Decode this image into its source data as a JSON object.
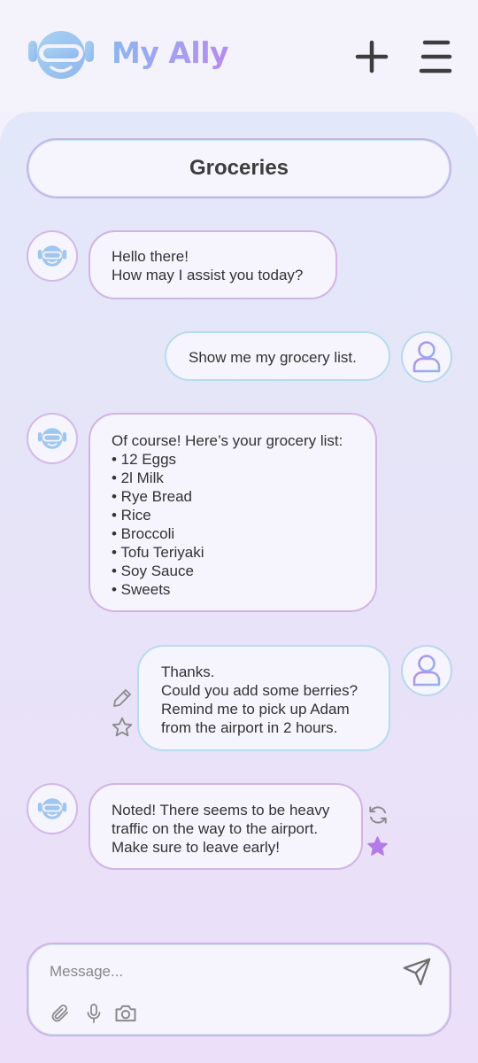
{
  "app": {
    "name": "My Ally"
  },
  "header": {
    "new_chat_icon": "plus-icon",
    "menu_icon": "menu-icon"
  },
  "conversation": {
    "title": "Groceries"
  },
  "messages": [
    {
      "sender": "bot",
      "lines": [
        "Hello there!",
        "How may I assist you today?"
      ]
    },
    {
      "sender": "user",
      "lines": [
        "Show me my grocery list."
      ]
    },
    {
      "sender": "bot",
      "lines": [
        "Of course! Here’s your grocery list:",
        "• 12 Eggs",
        "• 2l Milk",
        "• Rye Bread",
        "• Rice",
        "• Broccoli",
        "• Tofu Teriyaki",
        "• Soy Sauce",
        "• Sweets"
      ]
    },
    {
      "sender": "user",
      "lines": [
        "Thanks.",
        "Could you add some berries?",
        "Remind me to pick up Adam",
        "from the airport in 2 hours."
      ],
      "actions": [
        "edit-icon",
        "star-outline-icon"
      ]
    },
    {
      "sender": "bot",
      "lines": [
        "Noted! There seems to be heavy",
        "traffic on the way to the airport.",
        "Make sure to leave early!"
      ],
      "actions": [
        "regenerate-icon",
        "star-filled-icon"
      ]
    }
  ],
  "composer": {
    "placeholder": "Message...",
    "icons": [
      "paperclip-icon",
      "microphone-icon",
      "camera-icon",
      "send-icon"
    ]
  },
  "colors": {
    "brand_gradient_start": "#8fb6f0",
    "brand_gradient_end": "#b78cf0",
    "bot_border": "#d2b4e4",
    "user_border": "#b6dcef",
    "star_filled": "#b57ae8"
  }
}
